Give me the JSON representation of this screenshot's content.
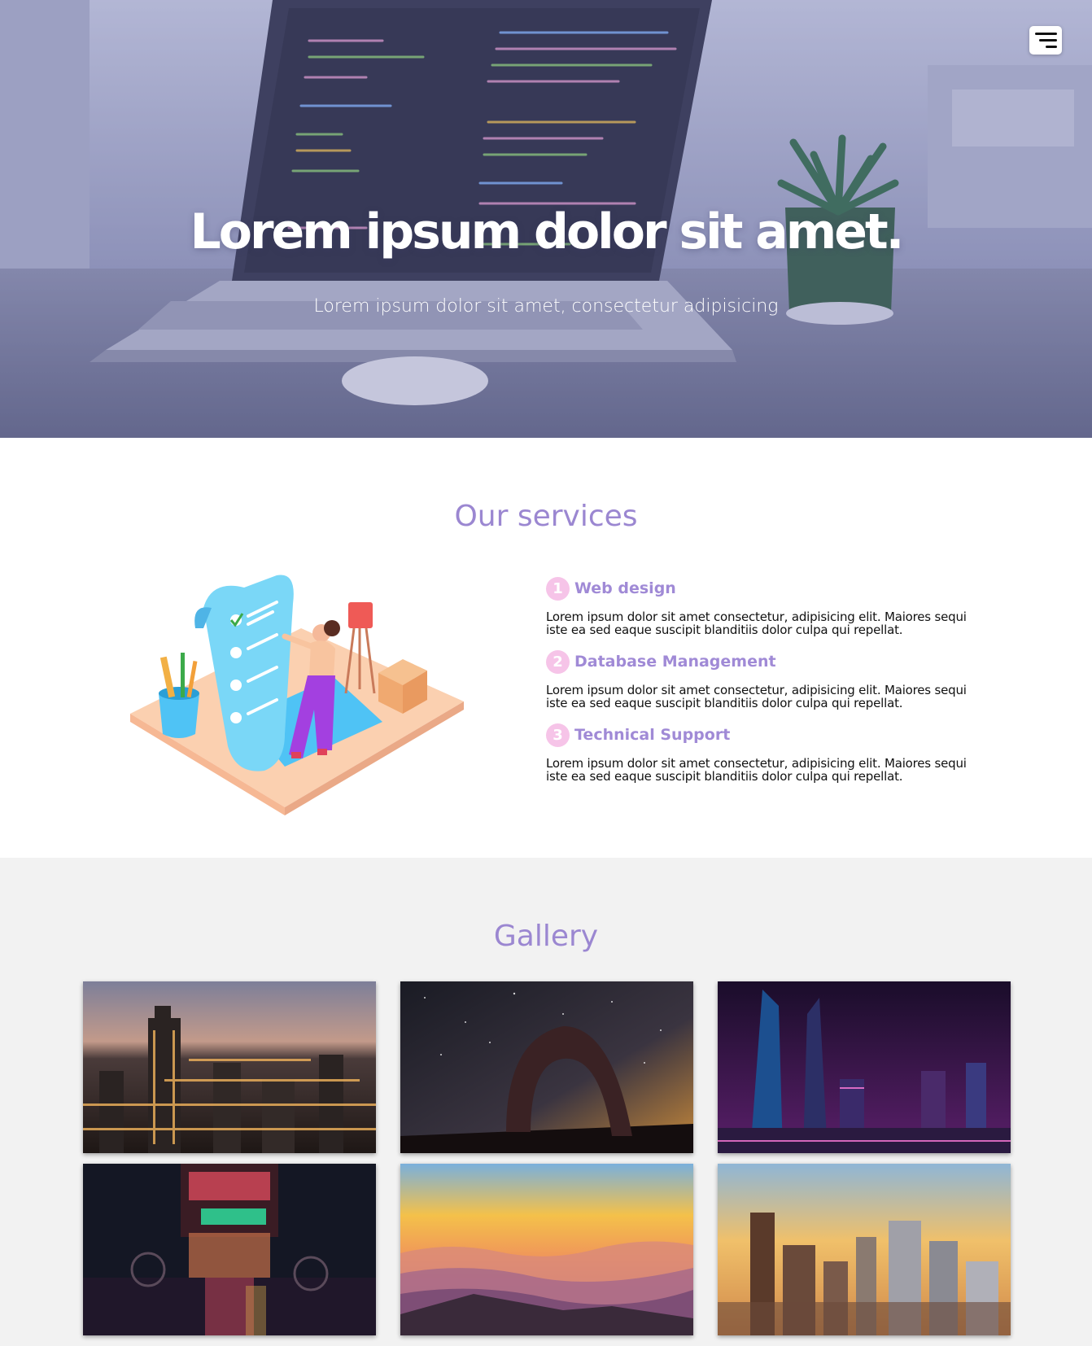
{
  "hero": {
    "title": "Lorem ipsum dolor sit amet.",
    "subtitle": "Lorem ipsum dolor sit amet, consectetur adipisicing",
    "menu_icon": "hamburger-menu-icon"
  },
  "services": {
    "title": "Our services",
    "illustration": "checklist-illustration",
    "items": [
      {
        "number": "1",
        "name": "Web design",
        "text": "Lorem ipsum dolor sit amet consectetur, adipisicing elit. Maiores sequi iste ea sed eaque suscipit blanditiis dolor culpa qui repellat."
      },
      {
        "number": "2",
        "name": "Database Management",
        "text": "Lorem ipsum dolor sit amet consectetur, adipisicing elit. Maiores sequi iste ea sed eaque suscipit blanditiis dolor culpa qui repellat."
      },
      {
        "number": "3",
        "name": "Technical Support",
        "text": "Lorem ipsum dolor sit amet consectetur, adipisicing elit. Maiores sequi iste ea sed eaque suscipit blanditiis dolor culpa qui repellat."
      }
    ]
  },
  "gallery": {
    "title": "Gallery",
    "images": [
      "city-night-skyline",
      "starry-rock-arch",
      "neon-skyscrapers",
      "rainy-neon-street",
      "sunset-mountains",
      "city-sunset-towers"
    ]
  },
  "colors": {
    "accent": "#9b87d1",
    "number_badge": "#f6c4e8",
    "section_bg": "#f2f2f2"
  }
}
